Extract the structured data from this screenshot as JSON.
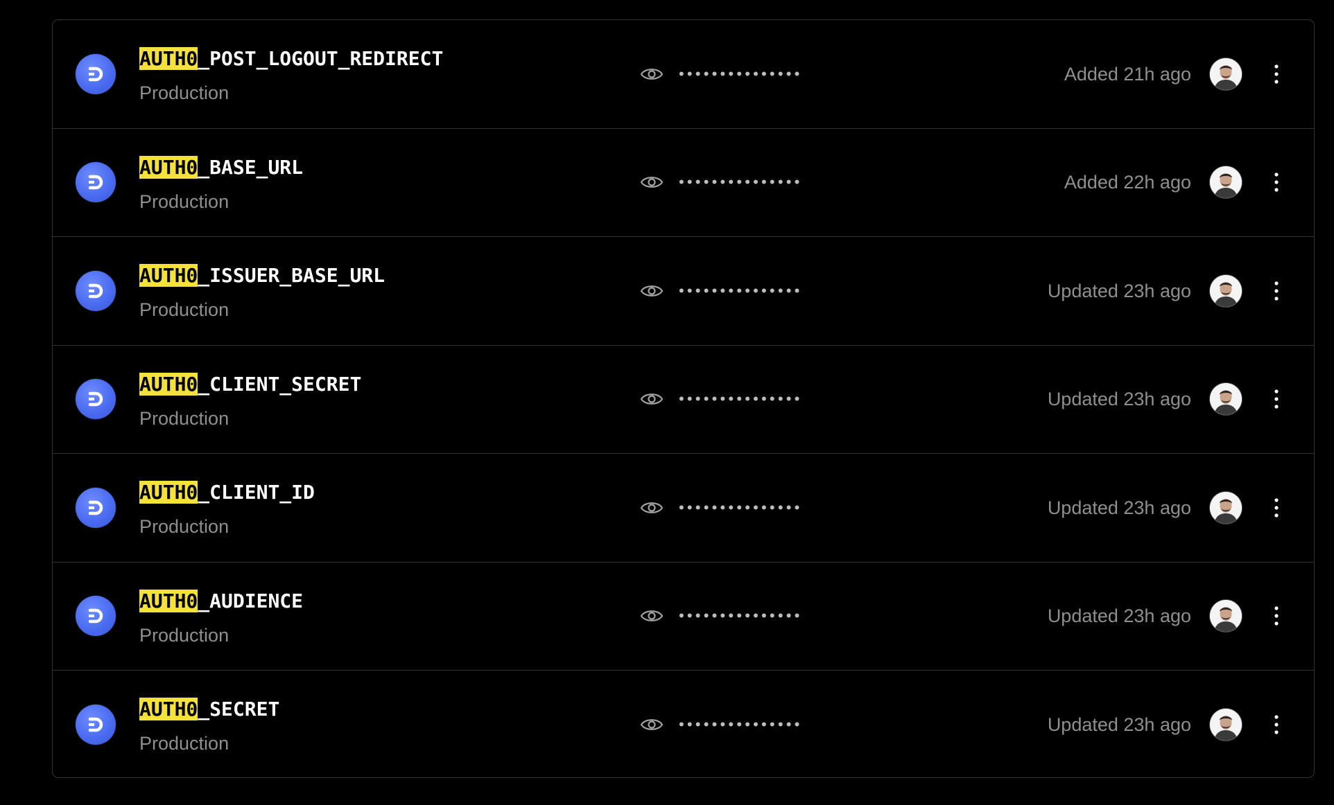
{
  "env_vars": [
    {
      "key_prefix": "AUTH0",
      "key_suffix": "_POST_LOGOUT_REDIRECT",
      "target": "Production",
      "masked_value": "•••••••••••••••",
      "status": "Added 21h ago"
    },
    {
      "key_prefix": "AUTH0",
      "key_suffix": "_BASE_URL",
      "target": "Production",
      "masked_value": "•••••••••••••••",
      "status": "Added 22h ago"
    },
    {
      "key_prefix": "AUTH0",
      "key_suffix": "_ISSUER_BASE_URL",
      "target": "Production",
      "masked_value": "•••••••••••••••",
      "status": "Updated 23h ago"
    },
    {
      "key_prefix": "AUTH0",
      "key_suffix": "_CLIENT_SECRET",
      "target": "Production",
      "masked_value": "•••••••••••••••",
      "status": "Updated 23h ago"
    },
    {
      "key_prefix": "AUTH0",
      "key_suffix": "_CLIENT_ID",
      "target": "Production",
      "masked_value": "•••••••••••••••",
      "status": "Updated 23h ago"
    },
    {
      "key_prefix": "AUTH0",
      "key_suffix": "_AUDIENCE",
      "target": "Production",
      "masked_value": "•••••••••••••••",
      "status": "Updated 23h ago"
    },
    {
      "key_prefix": "AUTH0",
      "key_suffix": "_SECRET",
      "target": "Production",
      "masked_value": "•••••••••••••••",
      "status": "Updated 23h ago"
    }
  ],
  "icons": {
    "integration": "integration-logo-icon",
    "reveal": "eye-icon",
    "avatar": "user-avatar",
    "more": "more-vertical-icon"
  },
  "colors": {
    "background": "#000000",
    "border": "#333333",
    "highlight": "#f4e13a",
    "integration_blue": "#4a6cf0",
    "muted_text": "#8f8f8f"
  }
}
